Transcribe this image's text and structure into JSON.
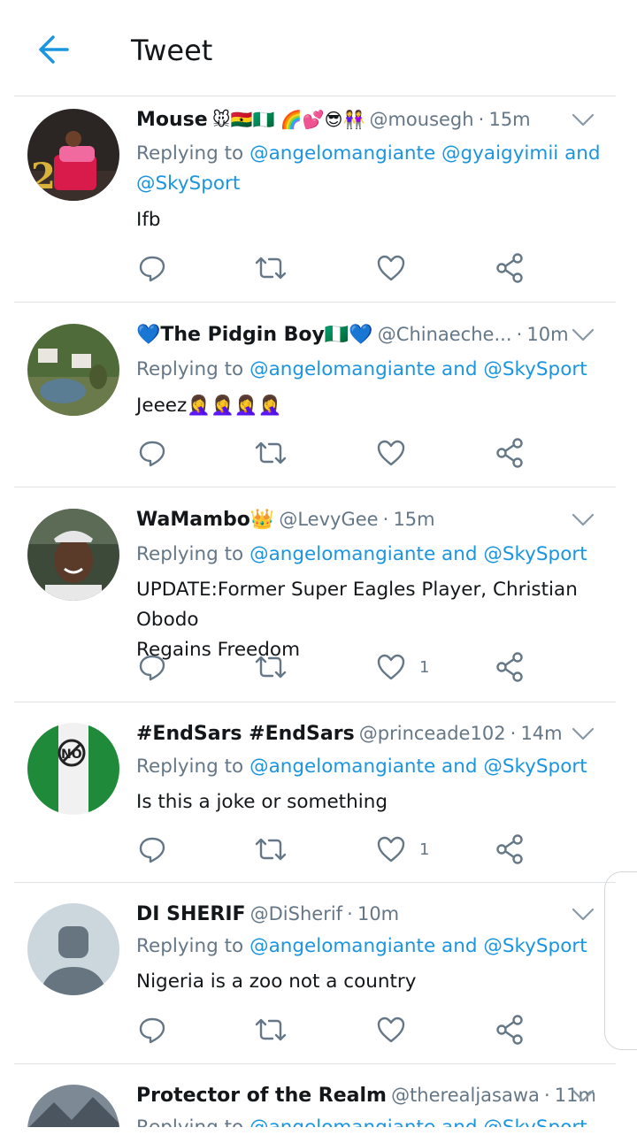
{
  "header": {
    "title": "Tweet",
    "back_icon": "arrow-left-icon"
  },
  "colors": {
    "accent": "#1b95e0",
    "secondary_text": "#657786",
    "divider": "#dfe3e6"
  },
  "tweets": [
    {
      "name": "Mouse",
      "emoji": "🐭🇬🇭🇳🇬 🌈💕😎👭",
      "handle": "@mousegh",
      "time": "15m",
      "replying_prefix": "Replying to",
      "mentions_line1": "@angelomangiante @gyaigyimii",
      "and_word": "and",
      "mentions_line2": "@SkySport",
      "text": "Ifb",
      "like_count": ""
    },
    {
      "name": "💙The Pidgin Boy🇳🇬💙",
      "emoji": "",
      "handle": "@Chinaeche...",
      "time": "10m",
      "replying_prefix": "Replying to",
      "mention_a": "@angelomangiante",
      "and_word": "and",
      "mention_b": "@SkySport",
      "text": "Jeeez🤦‍♀️🤦‍♀️🤦‍♀️🤦‍♀️",
      "like_count": ""
    },
    {
      "name": "WaMambo👑",
      "emoji": "",
      "handle": "@LevyGee",
      "time": "15m",
      "replying_prefix": "Replying to",
      "mention_a": "@angelomangiante",
      "and_word": "and",
      "mention_b": "@SkySport",
      "text_line1": "UPDATE:Former Super Eagles Player, Christian Obodo",
      "text_line2": "Regains Freedom",
      "like_count": "1"
    },
    {
      "name": "#EndSars #EndSars",
      "emoji": "",
      "handle": "@princeade102",
      "time": "14m",
      "replying_prefix": "Replying to",
      "mention_a": "@angelomangiante",
      "and_word": "and",
      "mention_b": "@SkySport",
      "text": "Is this a joke or something",
      "like_count": "1"
    },
    {
      "name": "DI SHERIF",
      "emoji": "",
      "handle": "@DiSherif",
      "time": "10m",
      "replying_prefix": "Replying to",
      "mention_a": "@angelomangiante",
      "and_word": "and",
      "mention_b": "@SkySport",
      "text": "Nigeria is a zoo not a country",
      "like_count": ""
    },
    {
      "name": "Protector of the Realm",
      "emoji": "",
      "handle": "@therealjasawa",
      "time": "11m",
      "replying_prefix": "Replying to",
      "mention_a": "@angelomangiante",
      "and_word": "and",
      "mention_b": "@SkySport"
    }
  ],
  "dot": "·",
  "icons": {
    "reply": "reply-icon",
    "retweet": "retweet-icon",
    "like": "heart-icon",
    "share": "share-icon",
    "caret": "chevron-down-icon"
  }
}
